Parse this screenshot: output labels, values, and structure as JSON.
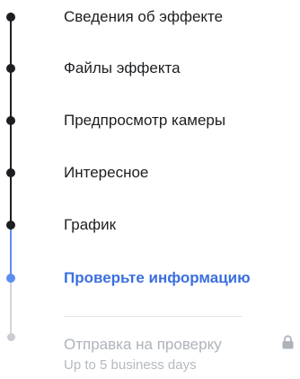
{
  "steps": [
    {
      "label": "Сведения об эффекте",
      "state": "done"
    },
    {
      "label": "Файлы эффекта",
      "state": "done"
    },
    {
      "label": "Предпросмотр камеры",
      "state": "done"
    },
    {
      "label": "Интересное",
      "state": "done"
    },
    {
      "label": "График",
      "state": "done"
    },
    {
      "label": "Проверьте информацию",
      "state": "active"
    },
    {
      "label": "Отправка на проверку",
      "state": "pending",
      "sublabel": "Up to 5 business days",
      "icon": "lock-icon"
    }
  ],
  "colors": {
    "done": "#1c1e21",
    "active": "#3b6fe0",
    "pending": "#aeb3ba"
  }
}
